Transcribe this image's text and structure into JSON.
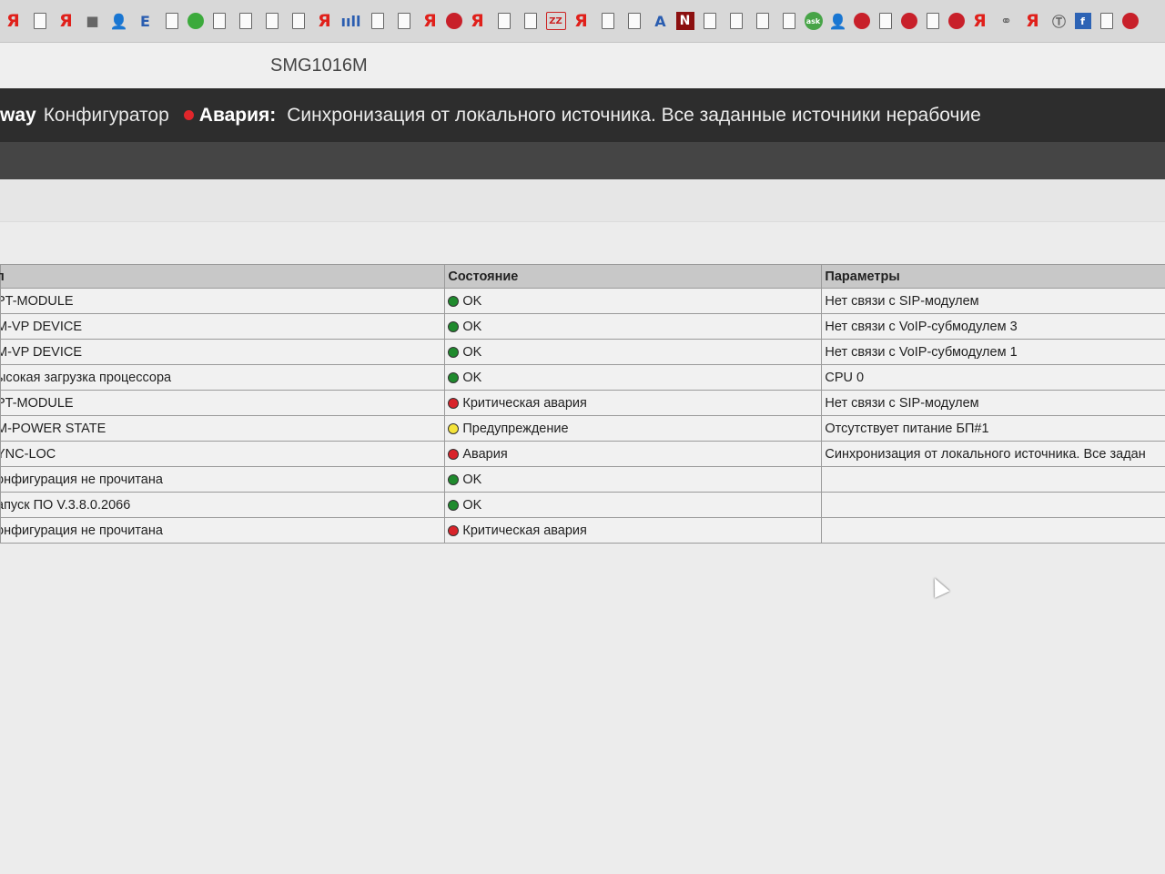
{
  "bookmarks": [
    {
      "icon": "ya-icon",
      "glyph": "Я",
      "kind": "ya"
    },
    {
      "icon": "page-icon",
      "glyph": "",
      "kind": "doc"
    },
    {
      "icon": "ya-icon",
      "glyph": "Я",
      "kind": "ya"
    },
    {
      "icon": "hat-icon",
      "glyph": "■",
      "kind": "gray"
    },
    {
      "icon": "person-icon",
      "glyph": "👤",
      "kind": "person"
    },
    {
      "icon": "e-icon",
      "glyph": "E",
      "kind": "blue"
    },
    {
      "icon": "page-icon",
      "glyph": "",
      "kind": "doc"
    },
    {
      "icon": "green-circle-icon",
      "glyph": "",
      "kind": "circle-green"
    },
    {
      "icon": "page-icon",
      "glyph": "",
      "kind": "doc"
    },
    {
      "icon": "page-icon",
      "glyph": "",
      "kind": "doc"
    },
    {
      "icon": "page-icon",
      "glyph": "",
      "kind": "doc"
    },
    {
      "icon": "page-icon",
      "glyph": "",
      "kind": "doc"
    },
    {
      "icon": "ya-icon",
      "glyph": "Я",
      "kind": "ya"
    },
    {
      "icon": "signal-icon",
      "glyph": "ııll",
      "kind": "blue"
    },
    {
      "icon": "page-icon",
      "glyph": "",
      "kind": "doc"
    },
    {
      "icon": "page-icon",
      "glyph": "",
      "kind": "doc"
    },
    {
      "icon": "ya-icon",
      "glyph": "Я",
      "kind": "ya"
    },
    {
      "icon": "red-circle-icon",
      "glyph": "",
      "kind": "circle-red"
    },
    {
      "icon": "ya-icon",
      "glyph": "Я",
      "kind": "ya"
    },
    {
      "icon": "page-icon",
      "glyph": "",
      "kind": "doc"
    },
    {
      "icon": "page-icon",
      "glyph": "",
      "kind": "doc"
    },
    {
      "icon": "zz-icon",
      "glyph": "ZZ",
      "kind": "box"
    },
    {
      "icon": "ya-icon",
      "glyph": "Я",
      "kind": "ya"
    },
    {
      "icon": "page-icon",
      "glyph": "",
      "kind": "doc"
    },
    {
      "icon": "page-icon",
      "glyph": "",
      "kind": "doc"
    },
    {
      "icon": "triangle-icon",
      "glyph": "A",
      "kind": "blue"
    },
    {
      "icon": "n-icon",
      "glyph": "N",
      "kind": "darkred"
    },
    {
      "icon": "page-icon",
      "glyph": "",
      "kind": "doc"
    },
    {
      "icon": "page-icon",
      "glyph": "",
      "kind": "doc"
    },
    {
      "icon": "page-icon",
      "glyph": "",
      "kind": "doc"
    },
    {
      "icon": "page-icon",
      "glyph": "",
      "kind": "doc"
    },
    {
      "icon": "ask-icon",
      "glyph": "ask",
      "kind": "ask"
    },
    {
      "icon": "person-icon",
      "glyph": "👤",
      "kind": "person"
    },
    {
      "icon": "red-circle-icon",
      "glyph": "",
      "kind": "circle-red"
    },
    {
      "icon": "page-icon",
      "glyph": "",
      "kind": "doc"
    },
    {
      "icon": "red-circle-icon",
      "glyph": "",
      "kind": "circle-red"
    },
    {
      "icon": "page-icon",
      "glyph": "",
      "kind": "doc"
    },
    {
      "icon": "red-circle-icon",
      "glyph": "",
      "kind": "circle-red"
    },
    {
      "icon": "ya-icon",
      "glyph": "Я",
      "kind": "ya"
    },
    {
      "icon": "link-icon",
      "glyph": "⚭",
      "kind": "gray"
    },
    {
      "icon": "ya-icon",
      "glyph": "Я",
      "kind": "ya"
    },
    {
      "icon": "t-icon",
      "glyph": "Ⓣ",
      "kind": "gray"
    },
    {
      "icon": "square-blue-icon",
      "glyph": "f",
      "kind": "sq-blue"
    },
    {
      "icon": "page-icon",
      "glyph": "",
      "kind": "doc"
    },
    {
      "icon": "red-circle-icon",
      "glyph": "",
      "kind": "circle-red"
    }
  ],
  "window": {
    "title": "SMG1016M"
  },
  "header": {
    "brand": "way",
    "app_name": "Конфигуратор",
    "alarm_label": "Авария:",
    "alarm_text": "Синхронизация от локального источника. Все заданные источники нерабочие",
    "alarm_color": "#e0262b"
  },
  "table": {
    "headers": [
      "п",
      "Состояние",
      "Параметры"
    ],
    "rows": [
      {
        "type": "PT-MODULE",
        "state": "OK",
        "state_color": "green",
        "params": "Нет связи с SIP-модулем"
      },
      {
        "type": "M-VP DEVICE",
        "state": "OK",
        "state_color": "green",
        "params": "Нет связи с VoIP-субмодулем 3"
      },
      {
        "type": "M-VP DEVICE",
        "state": "OK",
        "state_color": "green",
        "params": "Нет связи с VoIP-субмодулем 1"
      },
      {
        "type": "ысокая загрузка процессора",
        "state": "OK",
        "state_color": "green",
        "params": "CPU 0"
      },
      {
        "type": "PT-MODULE",
        "state": "Критическая авария",
        "state_color": "red",
        "params": "Нет связи с SIP-модулем"
      },
      {
        "type": "M-POWER STATE",
        "state": "Предупреждение",
        "state_color": "yellow",
        "params": "Отсутствует питание БП#1"
      },
      {
        "type": "YNC-LOC",
        "state": "Авария",
        "state_color": "red",
        "params": "Синхронизация от локального источника. Все задан"
      },
      {
        "type": "онфигурация не прочитана",
        "state": "OK",
        "state_color": "green",
        "params": ""
      },
      {
        "type": "апуск ПО V.3.8.0.2066",
        "state": "OK",
        "state_color": "green",
        "params": ""
      },
      {
        "type": "онфигурация не прочитана",
        "state": "Критическая авария",
        "state_color": "red",
        "params": ""
      }
    ]
  },
  "status_colors": {
    "green": "#1f8a2d",
    "red": "#d8232a",
    "yellow": "#f4e33a"
  }
}
